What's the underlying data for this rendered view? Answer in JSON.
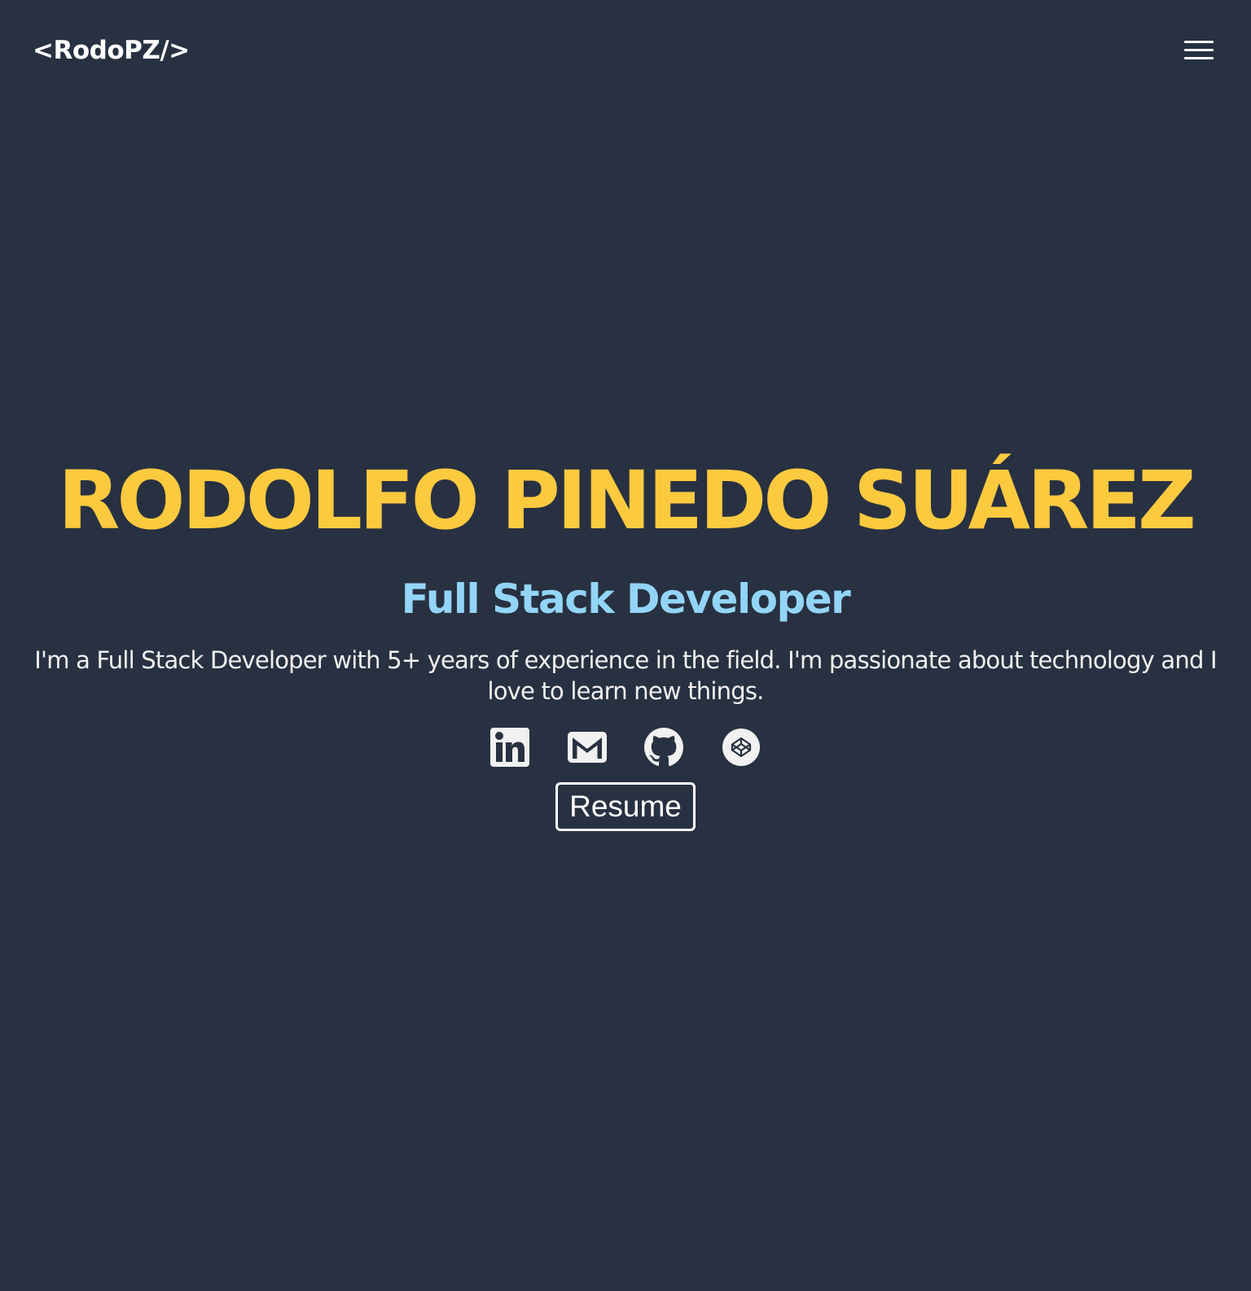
{
  "header": {
    "logo": "<RodoPZ/>",
    "menu_icon": "hamburger-menu-icon"
  },
  "hero": {
    "name": "RODOLFO PINEDO SUÁREZ",
    "role": "Full Stack Developer",
    "bio": "I'm a Full Stack Developer with 5+ years of experience in the field. I'm passionate about technology and I love to learn new things.",
    "social_icons": [
      "linkedin-icon",
      "gmail-icon",
      "github-icon",
      "codepen-icon"
    ],
    "resume_label": "Resume"
  },
  "colors": {
    "background": "#283141",
    "name": "#fcca3f",
    "role": "#93d5f7",
    "text": "#f1f1f1"
  }
}
